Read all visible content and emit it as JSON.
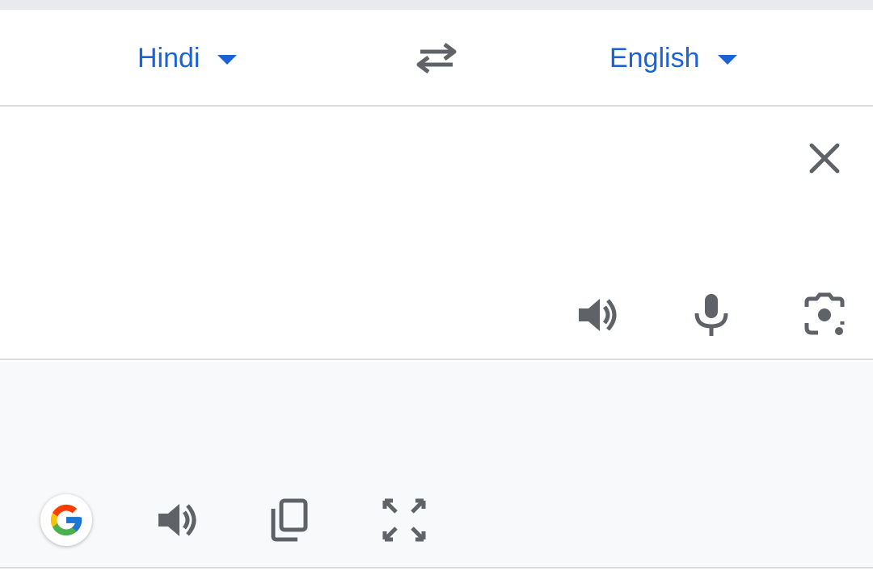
{
  "language_bar": {
    "source_language": "Hindi",
    "target_language": "English"
  },
  "source": {
    "text": ""
  },
  "result": {
    "text": ""
  },
  "icons": {
    "swap": "swap-arrows-icon",
    "clear": "close-icon",
    "source_listen": "speaker-icon",
    "mic": "microphone-icon",
    "camera": "camera-lens-icon",
    "google": "google-g-icon",
    "result_listen": "speaker-icon",
    "copy": "copy-icon",
    "fullscreen": "fullscreen-icon"
  },
  "colors": {
    "accent": "#1a62d6",
    "icon": "#5f6368",
    "text": "#202124",
    "result_background": "#f8f9fa"
  }
}
